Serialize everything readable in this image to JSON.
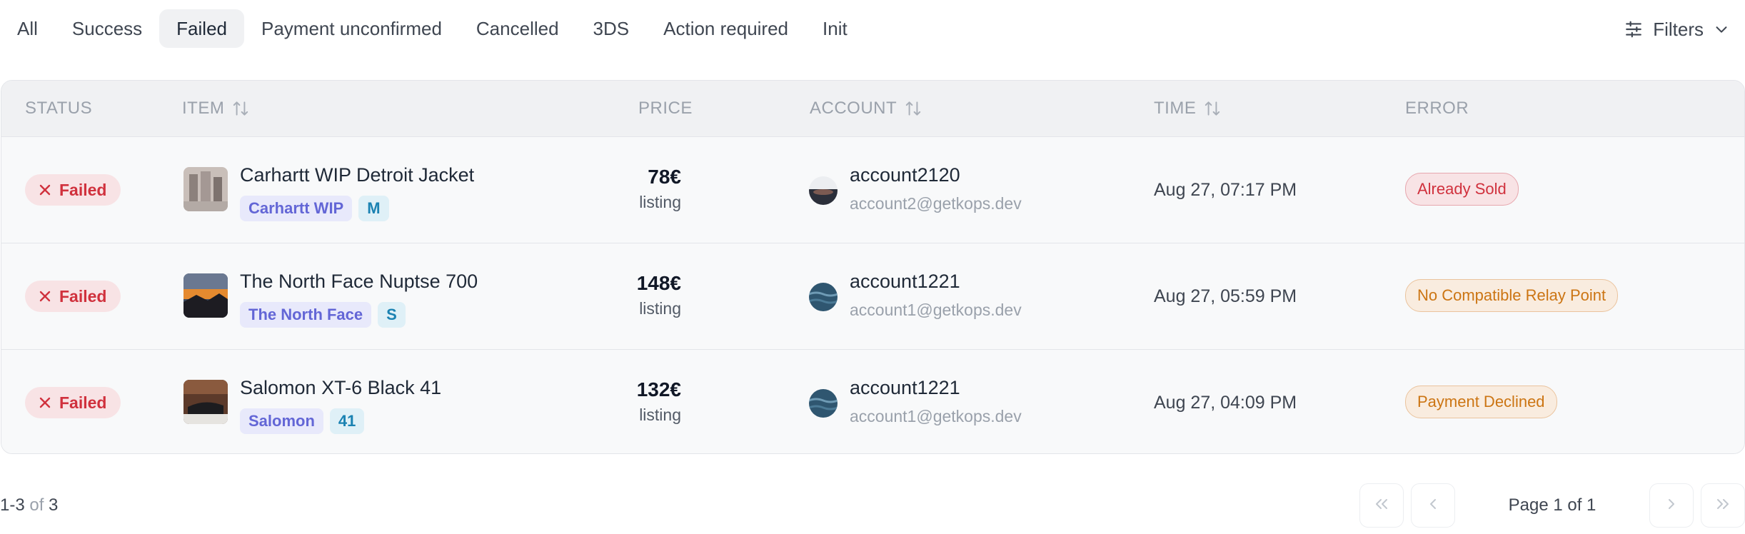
{
  "tabs": [
    {
      "label": "All",
      "active": false
    },
    {
      "label": "Success",
      "active": false
    },
    {
      "label": "Failed",
      "active": true
    },
    {
      "label": "Payment unconfirmed",
      "active": false
    },
    {
      "label": "Cancelled",
      "active": false
    },
    {
      "label": "3DS",
      "active": false
    },
    {
      "label": "Action required",
      "active": false
    },
    {
      "label": "Init",
      "active": false
    }
  ],
  "filters_label": "Filters",
  "columns": {
    "status": "STATUS",
    "item": "ITEM",
    "price": "PRICE",
    "account": "ACCOUNT",
    "time": "TIME",
    "error": "ERROR"
  },
  "rows": [
    {
      "status": "Failed",
      "item_title": "Carhartt WIP Detroit Jacket",
      "brand": "Carhartt WIP",
      "size": "M",
      "price": "78€",
      "price_sub": "listing",
      "account_name": "account2120",
      "account_email": "account2@getkops.dev",
      "time": "Aug 27, 07:17 PM",
      "error": "Already Sold",
      "error_color": "#d0313d"
    },
    {
      "status": "Failed",
      "item_title": "The North Face Nuptse 700",
      "brand": "The North Face",
      "size": "S",
      "price": "148€",
      "price_sub": "listing",
      "account_name": "account1221",
      "account_email": "account1@getkops.dev",
      "time": "Aug 27, 05:59 PM",
      "error": "No Compatible Relay Point",
      "error_color": "#cc7513"
    },
    {
      "status": "Failed",
      "item_title": "Salomon XT-6 Black 41",
      "brand": "Salomon",
      "size": "41",
      "price": "132€",
      "price_sub": "listing",
      "account_name": "account1221",
      "account_email": "account1@getkops.dev",
      "time": "Aug 27, 04:09 PM",
      "error": "Payment Declined",
      "error_color": "#cc7513"
    }
  ],
  "footer": {
    "range": "1-3",
    "of": "of",
    "total": "3",
    "page_info": "Page 1 of 1"
  }
}
